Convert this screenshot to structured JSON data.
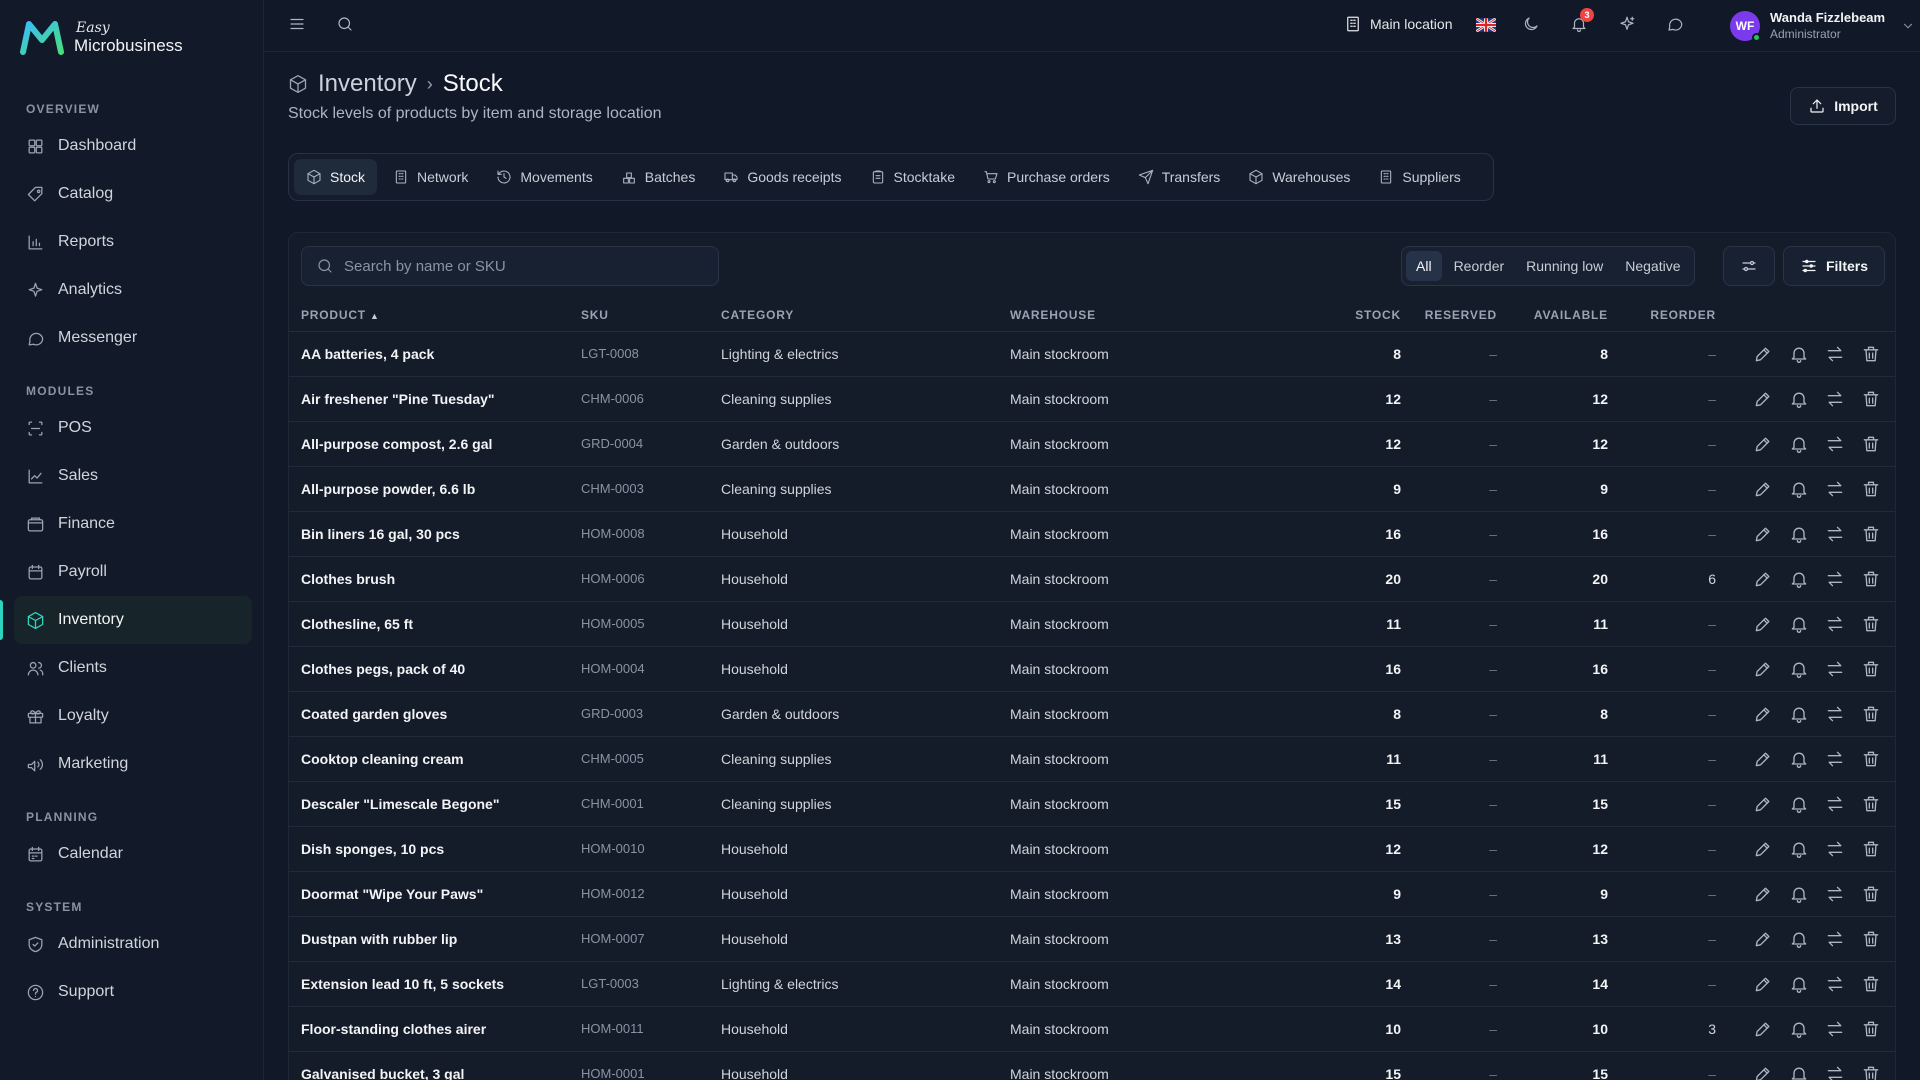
{
  "brand": {
    "easy": "Easy",
    "name": "Microbusiness"
  },
  "sidebar": {
    "sections": [
      {
        "title": "OVERVIEW",
        "items": [
          {
            "label": "Dashboard",
            "icon": "dashboard-icon"
          },
          {
            "label": "Catalog",
            "icon": "catalog-icon"
          },
          {
            "label": "Reports",
            "icon": "reports-icon"
          },
          {
            "label": "Analytics",
            "icon": "analytics-icon"
          },
          {
            "label": "Messenger",
            "icon": "messenger-icon"
          }
        ]
      },
      {
        "title": "MODULES",
        "items": [
          {
            "label": "POS",
            "icon": "pos-icon"
          },
          {
            "label": "Sales",
            "icon": "sales-icon"
          },
          {
            "label": "Finance",
            "icon": "finance-icon"
          },
          {
            "label": "Payroll",
            "icon": "payroll-icon"
          },
          {
            "label": "Inventory",
            "icon": "inventory-icon",
            "active": true
          },
          {
            "label": "Clients",
            "icon": "clients-icon"
          },
          {
            "label": "Loyalty",
            "icon": "loyalty-icon"
          },
          {
            "label": "Marketing",
            "icon": "marketing-icon"
          }
        ]
      },
      {
        "title": "PLANNING",
        "items": [
          {
            "label": "Calendar",
            "icon": "calendar-icon"
          }
        ]
      },
      {
        "title": "SYSTEM",
        "items": [
          {
            "label": "Administration",
            "icon": "administration-icon"
          },
          {
            "label": "Support",
            "icon": "support-icon"
          }
        ]
      }
    ]
  },
  "topbar": {
    "location": "Main location",
    "notification_count": "3",
    "user": {
      "initials": "WF",
      "name": "Wanda Fizzlebeam",
      "role": "Administrator"
    }
  },
  "header": {
    "breadcrumb_parent": "Inventory",
    "breadcrumb_separator": "›",
    "title": "Stock",
    "subtitle": "Stock levels of products by item and storage location",
    "import_label": "Import"
  },
  "tabs": [
    {
      "label": "Stock",
      "icon": "stock-icon",
      "active": true
    },
    {
      "label": "Network",
      "icon": "network-icon"
    },
    {
      "label": "Movements",
      "icon": "movements-icon"
    },
    {
      "label": "Batches",
      "icon": "batches-icon"
    },
    {
      "label": "Goods receipts",
      "icon": "goods-receipts-icon"
    },
    {
      "label": "Stocktake",
      "icon": "stocktake-icon"
    },
    {
      "label": "Purchase orders",
      "icon": "purchase-orders-icon"
    },
    {
      "label": "Transfers",
      "icon": "transfers-icon"
    },
    {
      "label": "Warehouses",
      "icon": "warehouses-icon"
    },
    {
      "label": "Suppliers",
      "icon": "suppliers-icon"
    }
  ],
  "toolbar": {
    "search_placeholder": "Search by name or SKU",
    "segments": [
      "All",
      "Reorder",
      "Running low",
      "Negative"
    ],
    "active_segment": "All",
    "filters_label": "Filters"
  },
  "table": {
    "columns": {
      "product": "PRODUCT",
      "sku": "SKU",
      "category": "CATEGORY",
      "warehouse": "WAREHOUSE",
      "stock": "STOCK",
      "reserved": "RESERVED",
      "available": "AVAILABLE",
      "reorder": "REORDER"
    },
    "rows": [
      {
        "product": "AA batteries, 4 pack",
        "sku": "LGT-0008",
        "category": "Lighting & electrics",
        "warehouse": "Main stockroom",
        "stock": "8",
        "reserved": "–",
        "available": "8",
        "reorder": "–"
      },
      {
        "product": "Air freshener \"Pine Tuesday\"",
        "sku": "CHM-0006",
        "category": "Cleaning supplies",
        "warehouse": "Main stockroom",
        "stock": "12",
        "reserved": "–",
        "available": "12",
        "reorder": "–"
      },
      {
        "product": "All-purpose compost, 2.6 gal",
        "sku": "GRD-0004",
        "category": "Garden & outdoors",
        "warehouse": "Main stockroom",
        "stock": "12",
        "reserved": "–",
        "available": "12",
        "reorder": "–"
      },
      {
        "product": "All-purpose powder, 6.6 lb",
        "sku": "CHM-0003",
        "category": "Cleaning supplies",
        "warehouse": "Main stockroom",
        "stock": "9",
        "reserved": "–",
        "available": "9",
        "reorder": "–"
      },
      {
        "product": "Bin liners 16 gal, 30 pcs",
        "sku": "HOM-0008",
        "category": "Household",
        "warehouse": "Main stockroom",
        "stock": "16",
        "reserved": "–",
        "available": "16",
        "reorder": "–"
      },
      {
        "product": "Clothes brush",
        "sku": "HOM-0006",
        "category": "Household",
        "warehouse": "Main stockroom",
        "stock": "20",
        "reserved": "–",
        "available": "20",
        "reorder": "6"
      },
      {
        "product": "Clothesline, 65 ft",
        "sku": "HOM-0005",
        "category": "Household",
        "warehouse": "Main stockroom",
        "stock": "11",
        "reserved": "–",
        "available": "11",
        "reorder": "–"
      },
      {
        "product": "Clothes pegs, pack of 40",
        "sku": "HOM-0004",
        "category": "Household",
        "warehouse": "Main stockroom",
        "stock": "16",
        "reserved": "–",
        "available": "16",
        "reorder": "–"
      },
      {
        "product": "Coated garden gloves",
        "sku": "GRD-0003",
        "category": "Garden & outdoors",
        "warehouse": "Main stockroom",
        "stock": "8",
        "reserved": "–",
        "available": "8",
        "reorder": "–"
      },
      {
        "product": "Cooktop cleaning cream",
        "sku": "CHM-0005",
        "category": "Cleaning supplies",
        "warehouse": "Main stockroom",
        "stock": "11",
        "reserved": "–",
        "available": "11",
        "reorder": "–"
      },
      {
        "product": "Descaler \"Limescale Begone\"",
        "sku": "CHM-0001",
        "category": "Cleaning supplies",
        "warehouse": "Main stockroom",
        "stock": "15",
        "reserved": "–",
        "available": "15",
        "reorder": "–"
      },
      {
        "product": "Dish sponges, 10 pcs",
        "sku": "HOM-0010",
        "category": "Household",
        "warehouse": "Main stockroom",
        "stock": "12",
        "reserved": "–",
        "available": "12",
        "reorder": "–"
      },
      {
        "product": "Doormat \"Wipe Your Paws\"",
        "sku": "HOM-0012",
        "category": "Household",
        "warehouse": "Main stockroom",
        "stock": "9",
        "reserved": "–",
        "available": "9",
        "reorder": "–"
      },
      {
        "product": "Dustpan with rubber lip",
        "sku": "HOM-0007",
        "category": "Household",
        "warehouse": "Main stockroom",
        "stock": "13",
        "reserved": "–",
        "available": "13",
        "reorder": "–"
      },
      {
        "product": "Extension lead 10 ft, 5 sockets",
        "sku": "LGT-0003",
        "category": "Lighting & electrics",
        "warehouse": "Main stockroom",
        "stock": "14",
        "reserved": "–",
        "available": "14",
        "reorder": "–"
      },
      {
        "product": "Floor-standing clothes airer",
        "sku": "HOM-0011",
        "category": "Household",
        "warehouse": "Main stockroom",
        "stock": "10",
        "reserved": "–",
        "available": "10",
        "reorder": "3"
      },
      {
        "product": "Galvanised bucket, 3 gal",
        "sku": "HOM-0001",
        "category": "Household",
        "warehouse": "Main stockroom",
        "stock": "15",
        "reserved": "–",
        "available": "15",
        "reorder": "–"
      }
    ]
  },
  "colors": {
    "accent": "#2dd4bf",
    "background": "#111827",
    "sidebar": "#121a2a",
    "avatar": "#7c3aed",
    "badge": "#ef4444"
  }
}
